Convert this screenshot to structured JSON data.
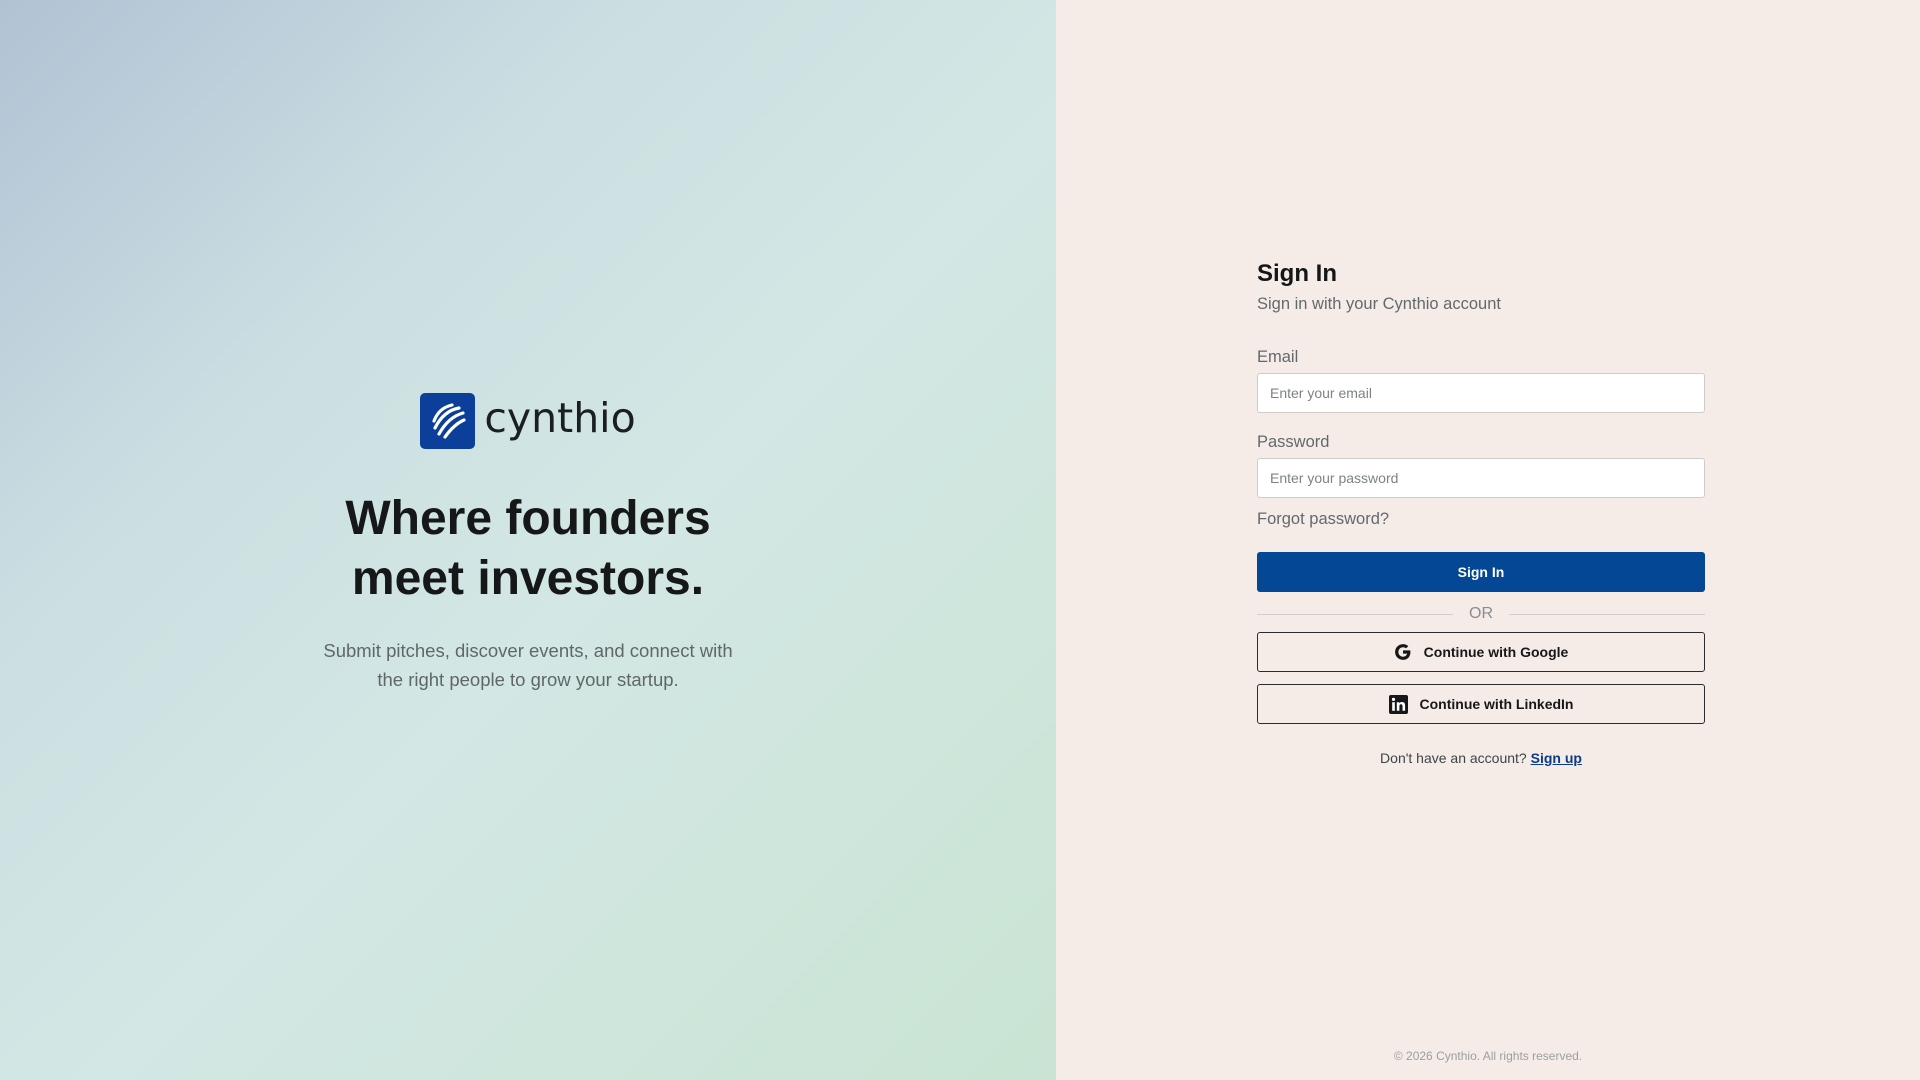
{
  "brand": {
    "name": "cynthio",
    "logo_icon": "swoosh-logo-icon",
    "logo_color": "#0b3f9a"
  },
  "hero": {
    "headline": "Where founders meet investors.",
    "subtext": "Submit pitches, discover events, and connect with the right people to grow your startup."
  },
  "form": {
    "title": "Sign In",
    "subtitle": "Sign in with your Cynthio account",
    "email_label": "Email",
    "email_placeholder": "Enter your email",
    "email_value": "",
    "password_label": "Password",
    "password_placeholder": "Enter your password",
    "password_value": "",
    "forgot_label": "Forgot password?",
    "submit_label": "Sign In",
    "divider_label": "OR",
    "google_label": "Continue with Google",
    "google_icon": "google-icon",
    "linkedin_label": "Continue with LinkedIn",
    "linkedin_icon": "linkedin-icon",
    "signup_prompt": "Don't have an account?",
    "signup_link": "Sign up"
  },
  "footer": {
    "copyright": "© 2026 Cynthio. All rights reserved."
  },
  "colors": {
    "primary": "#044794",
    "form_background": "#f5ece8",
    "text_dark": "#151718",
    "text_muted": "#62696c"
  }
}
